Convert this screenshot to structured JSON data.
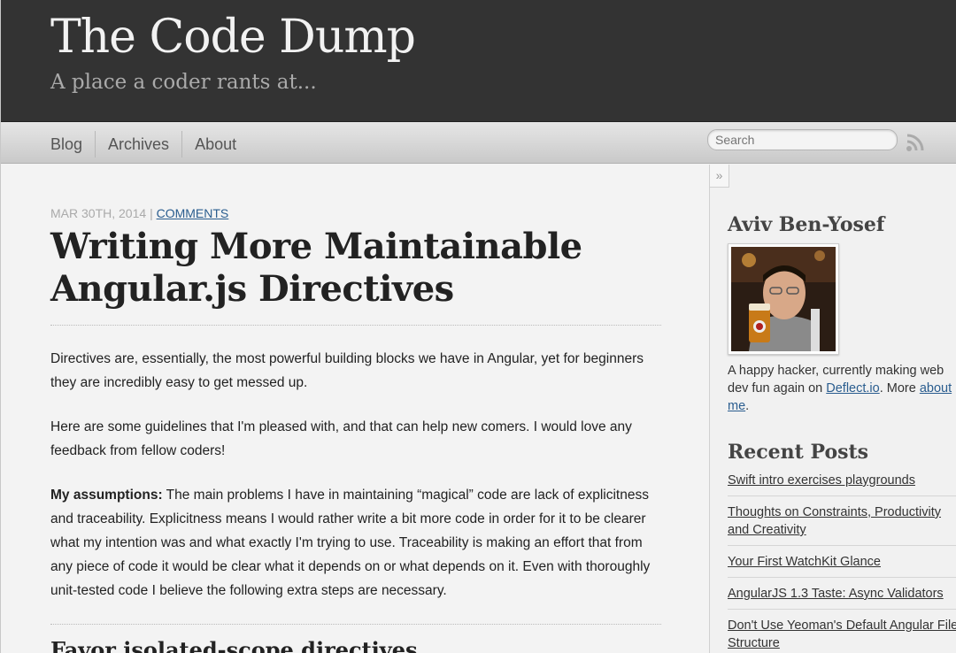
{
  "header": {
    "title": "The Code Dump",
    "subtitle": "A place a coder rants at..."
  },
  "nav": {
    "items": [
      {
        "label": "Blog"
      },
      {
        "label": "Archives"
      },
      {
        "label": "About"
      }
    ],
    "search_placeholder": "Search",
    "rss_icon": "rss-icon"
  },
  "post": {
    "date": "Mar 30th, 2014",
    "separator": "|",
    "comments_link": "Comments",
    "title": "Writing More Maintainable Angular.js Directives",
    "paragraphs": [
      "Directives are, essentially, the most powerful building blocks we have in Angular, yet for beginners they are incredibly easy to get messed up.",
      "Here are some guidelines that I'm pleased with, and that can help new comers. I would love any feedback from fellow coders!"
    ],
    "assumptions_label": "My assumptions:",
    "assumptions_text": " The main problems I have in maintaining “magical” code are lack of explicitness and traceability. Explicitness means I would rather write a bit more code in order for it to be clearer what my intention was and what exactly I'm trying to use. Traceability is making an effort that from any piece of code it would be clear what it depends on or what depends on it. Even with thoroughly unit-tested code I believe the following extra steps are necessary.",
    "next_heading": "Favor isolated-scope directives"
  },
  "sidebar": {
    "collapse_label": "»",
    "author": {
      "name": "Aviv Ben-Yosef",
      "bio_prefix": "A happy hacker, currently making web dev fun again on ",
      "bio_link": "Deflect.io",
      "bio_middle": ". More ",
      "bio_about_link": "about me",
      "bio_suffix": "."
    },
    "recent_heading": "Recent Posts",
    "recent_posts": [
      "Swift intro exercises playgrounds",
      "Thoughts on Constraints, Productivity and Creativity",
      "Your First WatchKit Glance",
      "AngularJS 1.3 Taste: Async Validators",
      "Don't Use Yeoman's Default Angular File Structure"
    ]
  },
  "colors": {
    "header_bg": "#333333",
    "link": "#2a5d8f"
  }
}
